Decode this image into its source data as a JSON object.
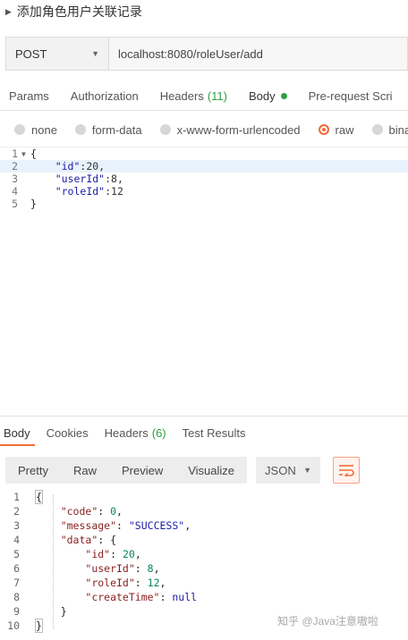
{
  "request": {
    "title": "添加角色用户关联记录",
    "method": "POST",
    "url": "localhost:8080/roleUser/add",
    "tabs": [
      {
        "label": "Params"
      },
      {
        "label": "Authorization"
      },
      {
        "label": "Headers",
        "count": "(11)"
      },
      {
        "label": "Body"
      },
      {
        "label": "Pre-request Scri"
      }
    ],
    "body_types": [
      "none",
      "form-data",
      "x-www-form-urlencoded",
      "raw",
      "binar"
    ],
    "selected_body_type": "raw",
    "editor_lines": [
      {
        "no": "1",
        "text": "{"
      },
      {
        "no": "2",
        "key": "\"id\"",
        "val": ":20,"
      },
      {
        "no": "3",
        "key": "\"userId\"",
        "val": ":8,"
      },
      {
        "no": "4",
        "key": "\"roleId\"",
        "val": ":12"
      },
      {
        "no": "5",
        "text": "}"
      }
    ]
  },
  "response": {
    "tabs": [
      {
        "label": "Body"
      },
      {
        "label": "Cookies"
      },
      {
        "label": "Headers",
        "count": "(6)"
      },
      {
        "label": "Test Results"
      }
    ],
    "view_modes": [
      "Pretty",
      "Raw",
      "Preview",
      "Visualize"
    ],
    "format": "JSON",
    "lines": [
      {
        "no": "1",
        "indent": "",
        "parts": [
          [
            "p",
            "{"
          ]
        ]
      },
      {
        "no": "2",
        "indent": "    ",
        "parts": [
          [
            "k",
            "\"code\""
          ],
          [
            "p",
            ": "
          ],
          [
            "n",
            "0"
          ],
          [
            "p",
            ","
          ]
        ]
      },
      {
        "no": "3",
        "indent": "    ",
        "parts": [
          [
            "k",
            "\"message\""
          ],
          [
            "p",
            ": "
          ],
          [
            "s",
            "\"SUCCESS\""
          ],
          [
            "p",
            ","
          ]
        ]
      },
      {
        "no": "4",
        "indent": "    ",
        "parts": [
          [
            "k",
            "\"data\""
          ],
          [
            "p",
            ": {"
          ]
        ]
      },
      {
        "no": "5",
        "indent": "        ",
        "parts": [
          [
            "k",
            "\"id\""
          ],
          [
            "p",
            ": "
          ],
          [
            "n",
            "20"
          ],
          [
            "p",
            ","
          ]
        ]
      },
      {
        "no": "6",
        "indent": "        ",
        "parts": [
          [
            "k",
            "\"userId\""
          ],
          [
            "p",
            ": "
          ],
          [
            "n",
            "8"
          ],
          [
            "p",
            ","
          ]
        ]
      },
      {
        "no": "7",
        "indent": "        ",
        "parts": [
          [
            "k",
            "\"roleId\""
          ],
          [
            "p",
            ": "
          ],
          [
            "n",
            "12"
          ],
          [
            "p",
            ","
          ]
        ]
      },
      {
        "no": "8",
        "indent": "        ",
        "parts": [
          [
            "k",
            "\"createTime\""
          ],
          [
            "p",
            ": "
          ],
          [
            "s",
            "null"
          ]
        ]
      },
      {
        "no": "9",
        "indent": "    ",
        "parts": [
          [
            "p",
            "}"
          ]
        ]
      },
      {
        "no": "10",
        "indent": "",
        "parts": [
          [
            "p",
            "}"
          ]
        ]
      }
    ]
  },
  "watermark": "知乎 @Java注意嗷啦",
  "colors": {
    "accent": "#f26b3a",
    "green": "#2f9e44"
  }
}
